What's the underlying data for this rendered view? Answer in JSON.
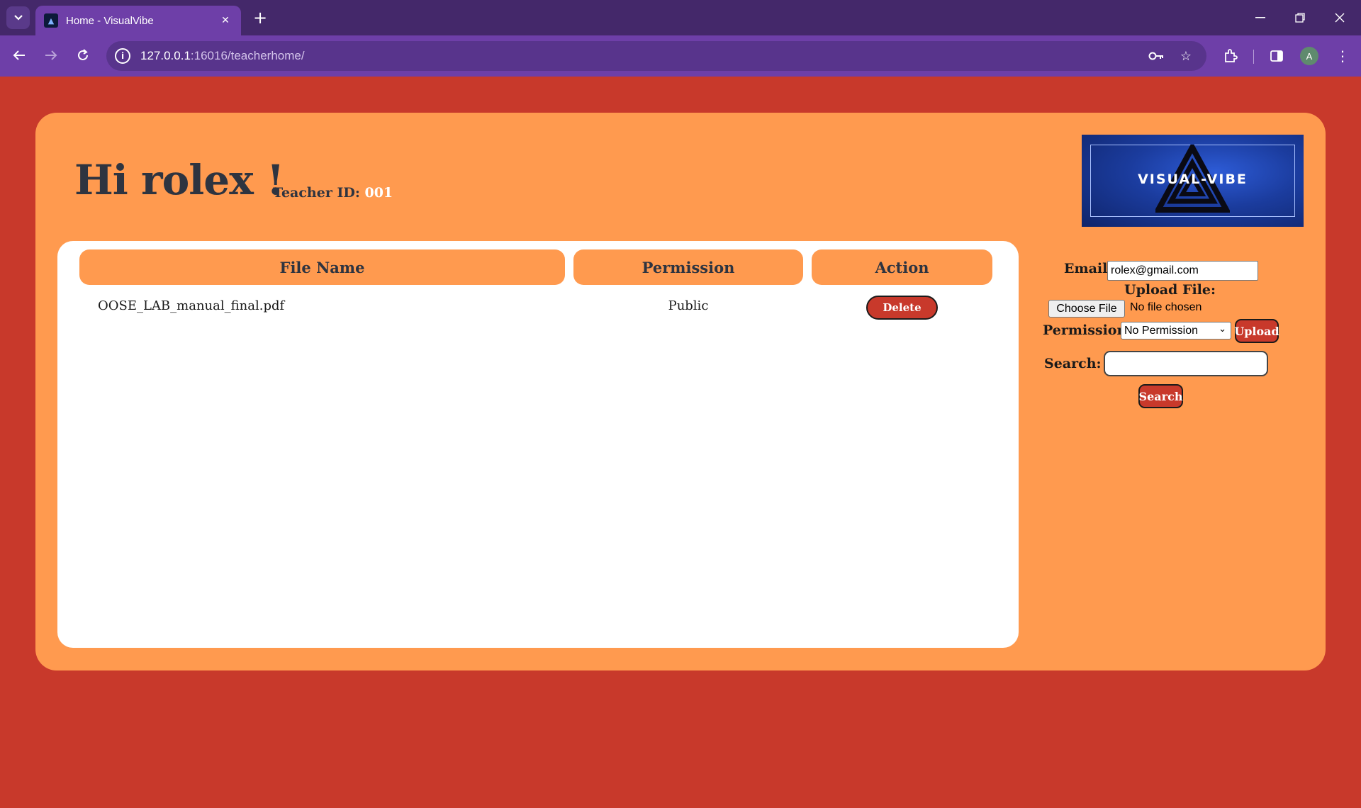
{
  "browser": {
    "tab_title": "Home - VisualVibe",
    "url_host": "127.0.0.1",
    "url_rest": ":16016/teacherhome/",
    "avatar_letter": "A"
  },
  "header": {
    "greeting": "Hi rolex !",
    "teacher_id_label": "Teacher ID:",
    "teacher_id_value": "001",
    "logo_text": "VISUAL-VIBE"
  },
  "table": {
    "columns": [
      "File Name",
      "Permission",
      "Action"
    ],
    "rows": [
      {
        "file_name": "OOSE_LAB_manual_final.pdf",
        "permission": "Public",
        "action": "Delete"
      }
    ]
  },
  "form": {
    "email_label": "Email:",
    "email_value": "rolex@gmail.com",
    "upload_label": "Upload File:",
    "choose_file_label": "Choose File",
    "no_file_text": "No file chosen",
    "permission_label": "Permission:",
    "permission_selected": "No Permission",
    "upload_button": "Upload",
    "search_label": "Search:",
    "search_value": "",
    "search_button": "Search"
  },
  "colors": {
    "page_bg": "#c8392b",
    "panel_bg": "#ff9a4f",
    "button_bg": "#c8392b",
    "chrome_dark": "#44286a",
    "chrome_light": "#6e3fa8"
  }
}
